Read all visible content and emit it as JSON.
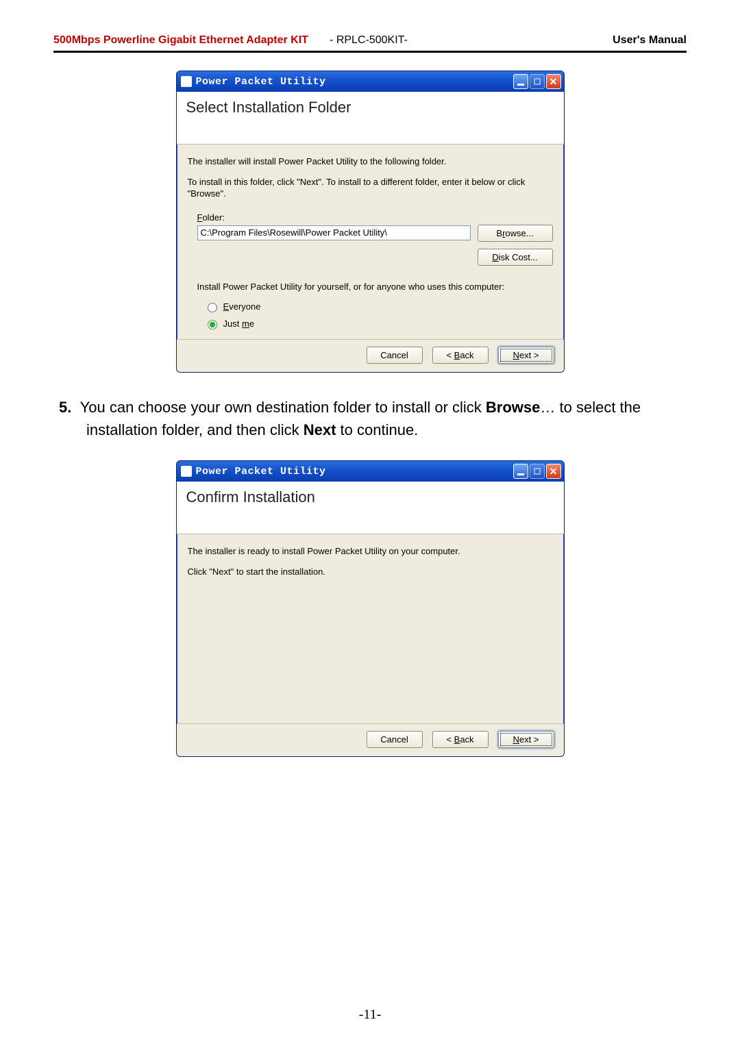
{
  "header": {
    "product_title": "500Mbps Powerline Gigabit Ethernet Adapter KIT",
    "model_prefix": "- ",
    "model": "RPLC-500KIT-",
    "manual_label": "User's Manual"
  },
  "dialog1": {
    "app_title": "Power Packet Utility",
    "heading": "Select Installation Folder",
    "line1": "The installer will install Power Packet Utility  to the following folder.",
    "line2": "To install in this folder, click \"Next\". To install to a different folder, enter it below or click \"Browse\".",
    "folder_label_pre": "F",
    "folder_label_rest": "older:",
    "folder_value": "C:\\Program Files\\Rosewill\\Power Packet Utility\\",
    "browse_pre": "B",
    "browse_u": "r",
    "browse_post": "owse...",
    "diskcost_u": "D",
    "diskcost_post": "isk Cost...",
    "install_for": "Install Power Packet Utility  for yourself, or for anyone who uses this computer:",
    "everyone_u": "E",
    "everyone_post": "veryone",
    "justme_pre": "Just ",
    "justme_u": "m",
    "justme_post": "e",
    "cancel": "Cancel",
    "back_lt": "< ",
    "back_u": "B",
    "back_post": "ack",
    "next_u": "N",
    "next_post": "ext >"
  },
  "step": {
    "num": "5.",
    "part1": "You can choose your own destination folder to install or click ",
    "bold1": "Browse",
    "part2": "… to select the installation folder, and then click ",
    "bold2": "Next",
    "part3": " to continue."
  },
  "dialog2": {
    "app_title": "Power Packet Utility",
    "heading": "Confirm Installation",
    "line1": "The installer is ready to install Power Packet Utility  on your computer.",
    "line2": "Click \"Next\" to start the installation.",
    "cancel": "Cancel",
    "back_lt": "< ",
    "back_u": "B",
    "back_post": "ack",
    "next_u": "N",
    "next_post": "ext >"
  },
  "page_number": "-11-"
}
